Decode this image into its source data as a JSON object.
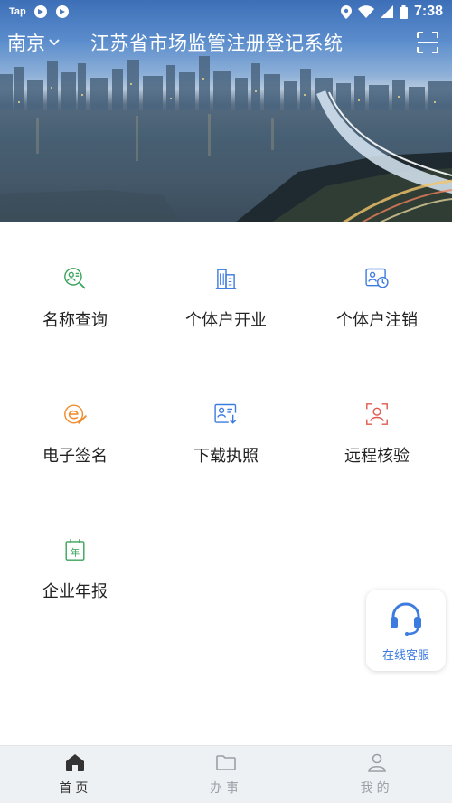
{
  "status_bar": {
    "carrier": "Tap",
    "time": "7:38"
  },
  "header": {
    "city": "南京",
    "title": "江苏省市场监管注册登记系统"
  },
  "services": [
    {
      "label": "名称查询",
      "icon": "name-search-icon",
      "color": "#3aa35b"
    },
    {
      "label": "个体户开业",
      "icon": "building-icon",
      "color": "#3c7be0"
    },
    {
      "label": "个体户注销",
      "icon": "user-cancel-icon",
      "color": "#3c7be0"
    },
    {
      "label": "电子签名",
      "icon": "e-signature-icon",
      "color": "#f08a2a"
    },
    {
      "label": "下载执照",
      "icon": "license-download-icon",
      "color": "#3c7be0"
    },
    {
      "label": "远程核验",
      "icon": "face-scan-icon",
      "color": "#e2574c"
    },
    {
      "label": "企业年报",
      "icon": "annual-report-icon",
      "color": "#3aa35b"
    }
  ],
  "customer_service": {
    "label": "在线客服",
    "icon": "headset-icon",
    "color": "#3c7be0"
  },
  "tabs": [
    {
      "label": "首页",
      "icon": "home-icon",
      "active": true
    },
    {
      "label": "办事",
      "icon": "folder-icon",
      "active": false
    },
    {
      "label": "我的",
      "icon": "user-icon",
      "active": false
    }
  ],
  "colors": {
    "accent_blue": "#3c7be0",
    "accent_green": "#3aa35b",
    "accent_orange": "#f08a2a",
    "accent_red": "#e2574c",
    "tab_active": "#333333",
    "tab_inactive": "#9aa0a6"
  }
}
